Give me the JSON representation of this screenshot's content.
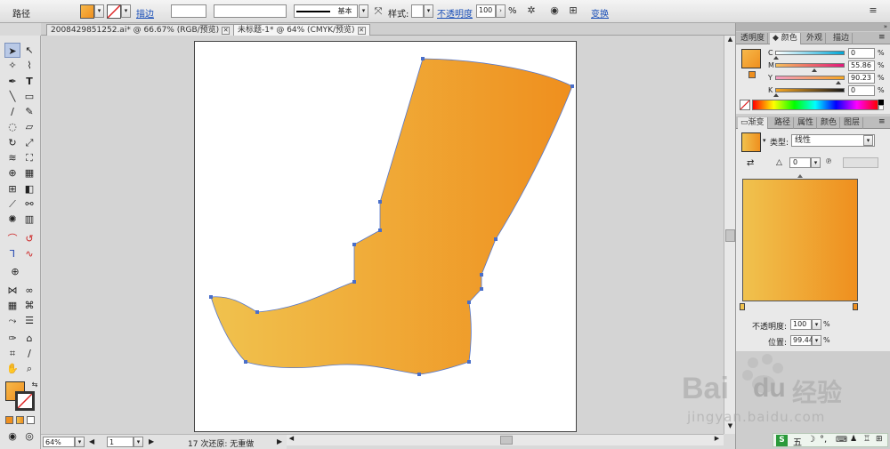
{
  "ctrlbar": {
    "object_type": "路径",
    "stroke_link": "描边",
    "stroke_style": "基本",
    "style_label": "样式:",
    "opacity_link": "不透明度",
    "opacity_value": "100",
    "opacity_unit": "%",
    "transform_link": "变换"
  },
  "tabs": [
    {
      "label": "2008429851252.ai* @ 66.67% (RGB/预览)"
    },
    {
      "label": "未标题-1* @ 64% (CMYK/预览)"
    }
  ],
  "status": {
    "zoom": "64%",
    "page": "1",
    "history": "17 次还原: 无重做"
  },
  "color_panel": {
    "tabs": [
      "透明度",
      "颜色",
      "外观",
      "描边"
    ],
    "channels": [
      {
        "name": "C",
        "value": "0"
      },
      {
        "name": "M",
        "value": "55.86"
      },
      {
        "name": "Y",
        "value": "90.23"
      },
      {
        "name": "K",
        "value": "0"
      }
    ],
    "unit": "%"
  },
  "gradient_panel": {
    "tabs": [
      "渐变",
      "路径",
      "属性",
      "颜色",
      "图层"
    ],
    "type_label": "类型:",
    "type_value": "线性",
    "angle_value": "0",
    "opacity_label": "不透明度:",
    "opacity_value": "100",
    "location_label": "位置:",
    "location_value": "99.44",
    "unit": "%"
  },
  "colors": {
    "gradient_start": "#f0c24e",
    "gradient_end": "#ef8f1e",
    "fill": "#f0901f",
    "path_anchor": "#4a6fc9"
  },
  "watermark": {
    "brand": "Bai",
    "brand2": "du",
    "cn": "经验",
    "url": "jingyan.baidu.com"
  },
  "ime": {
    "label": "五"
  }
}
